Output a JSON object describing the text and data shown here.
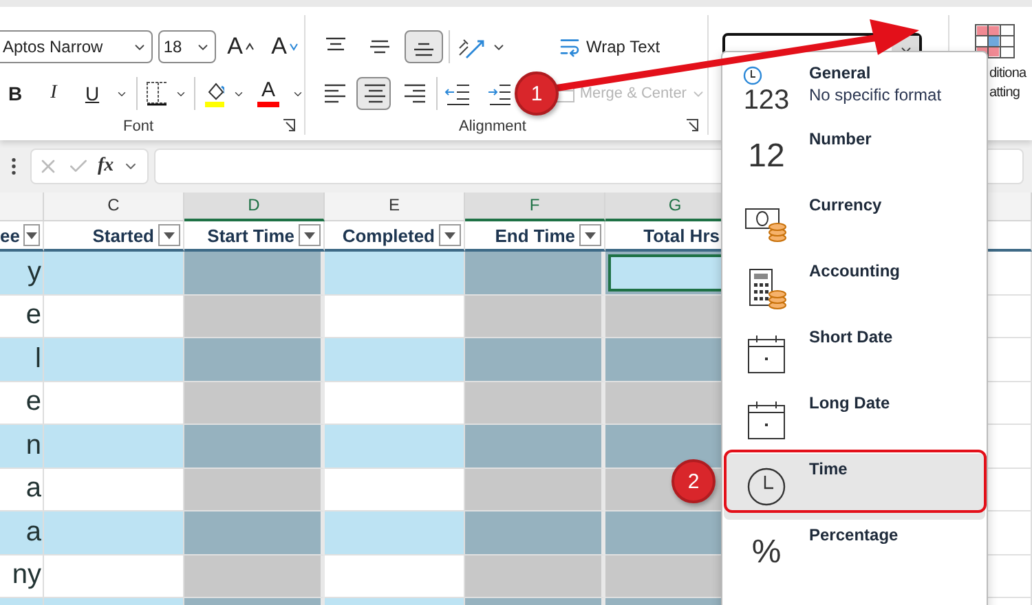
{
  "ribbon": {
    "font_group": {
      "title": "Font",
      "font_name": "Aptos Narrow",
      "font_size": "18",
      "size_buttons": [
        {
          "kind": "grow",
          "label": "A"
        },
        {
          "kind": "shrink",
          "label": "A"
        }
      ],
      "style_buttons": [
        {
          "kind": "bold",
          "label": "B"
        },
        {
          "kind": "italic",
          "label": "I"
        },
        {
          "kind": "underline",
          "label": "U"
        }
      ],
      "font_color_label": "A"
    },
    "alignment_group": {
      "title": "Alignment",
      "vertical": [
        {
          "kind": "top",
          "selected": false
        },
        {
          "kind": "middle",
          "selected": false
        },
        {
          "kind": "bottom",
          "selected": true
        }
      ],
      "horizontal": [
        {
          "kind": "left",
          "selected": false
        },
        {
          "kind": "center",
          "selected": true
        },
        {
          "kind": "right",
          "selected": false
        }
      ],
      "wrap_text": "Wrap Text",
      "merge": {
        "label": "Merge & Center",
        "disabled": true
      }
    },
    "conditional_formatting": {
      "label_lines": [
        "ditiona",
        "atting"
      ]
    }
  },
  "formula_bar": {
    "function_label": "fx"
  },
  "sheet": {
    "columns": [
      {
        "header": "ee",
        "selected": false,
        "filter": true
      },
      {
        "letter": "C",
        "header": "Started",
        "selected": false,
        "filter": true
      },
      {
        "letter": "D",
        "header": "Start Time",
        "selected": true,
        "filter": true
      },
      {
        "letter": "E",
        "header": "Completed",
        "selected": false,
        "filter": true
      },
      {
        "letter": "F",
        "header": "End Time",
        "selected": true,
        "filter": true
      },
      {
        "letter": "G",
        "header": "Total Hrs",
        "selected": true,
        "filter": false
      }
    ],
    "rows": [
      {
        "name": "y"
      },
      {
        "name": "e"
      },
      {
        "name": "l"
      },
      {
        "name": "e"
      },
      {
        "name": "n"
      },
      {
        "name": "a"
      },
      {
        "name": "a"
      },
      {
        "name": "ny"
      },
      {}
    ]
  },
  "format_menu": [
    {
      "kind": "general",
      "label": "General",
      "subtitle": "No specific format",
      "icon_text": "123",
      "selected": false
    },
    {
      "kind": "number",
      "label": "Number",
      "icon_text": "12",
      "selected": false
    },
    {
      "kind": "currency",
      "label": "Currency",
      "selected": false
    },
    {
      "kind": "accounting",
      "label": "Accounting",
      "selected": false
    },
    {
      "kind": "date",
      "label": "Short Date",
      "selected": false
    },
    {
      "kind": "date",
      "label": "Long Date",
      "selected": false
    },
    {
      "kind": "time",
      "label": "Time",
      "selected": true
    },
    {
      "kind": "percentage",
      "label": "Percentage",
      "icon_text": "%",
      "selected": false
    }
  ],
  "callouts": [
    {
      "label": "1"
    },
    {
      "label": "2"
    }
  ]
}
